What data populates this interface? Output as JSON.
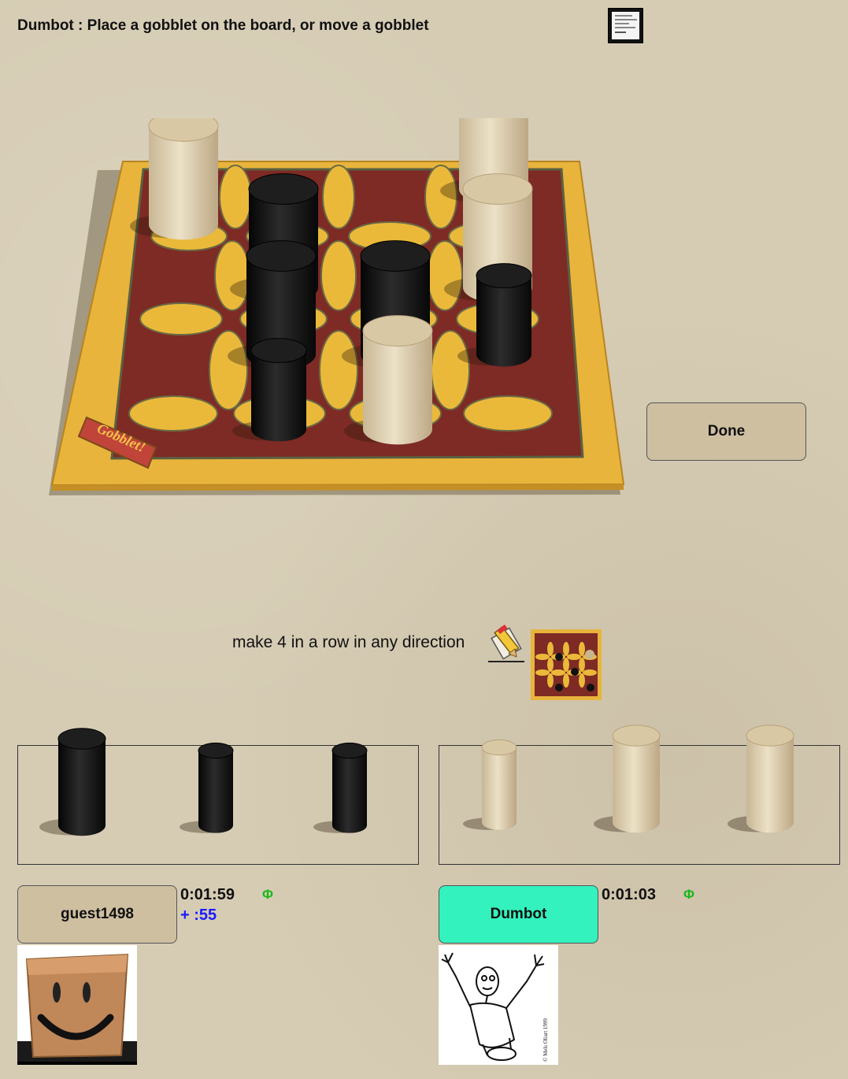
{
  "status": {
    "text": "Dumbot : Place a gobblet on the board, or move a gobblet"
  },
  "done_button": {
    "label": "Done"
  },
  "rules": {
    "text": "make 4 in a row in any direction"
  },
  "players": [
    {
      "name": "guest1498",
      "time": "0:01:59",
      "bonus": "+ :55",
      "phi": "Φ",
      "active": false,
      "color": "black"
    },
    {
      "name": "Dumbot",
      "time": "0:01:03",
      "bonus": "",
      "phi": "Φ",
      "active": true,
      "color": "white"
    }
  ],
  "colors": {
    "active_player": "#33f2bd",
    "button_bg": "#cfbfa1",
    "board_wood": "#e8b43c",
    "board_red": "#8a2f2c",
    "black_piece": "#141414",
    "white_piece": "#dccdae"
  },
  "board": {
    "brand": "Gobblet!",
    "grid": [
      [
        "white-large",
        "",
        "",
        "white-large"
      ],
      [
        "",
        "black-large",
        "",
        "white-large"
      ],
      [
        "",
        "black-large",
        "black-large",
        "black-medium"
      ],
      [
        "",
        "black-medium",
        "white-large",
        ""
      ]
    ]
  },
  "reserves": {
    "left": [
      "black-large",
      "black-medium",
      "black-medium"
    ],
    "right": [
      "white-medium",
      "white-large",
      "white-large"
    ]
  },
  "icons": {
    "document": "document-thumbnail-icon",
    "pencil": "pencil-ruler-icon",
    "board_view": "board-view-icon"
  }
}
